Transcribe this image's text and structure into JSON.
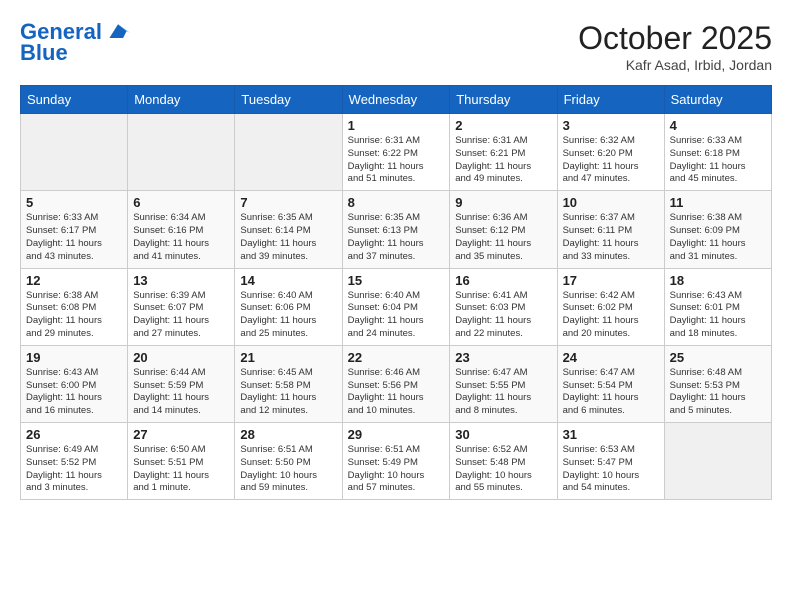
{
  "logo": {
    "line1": "General",
    "line2": "Blue"
  },
  "header": {
    "title": "October 2025",
    "subtitle": "Kafr Asad, Irbid, Jordan"
  },
  "weekdays": [
    "Sunday",
    "Monday",
    "Tuesday",
    "Wednesday",
    "Thursday",
    "Friday",
    "Saturday"
  ],
  "weeks": [
    [
      {
        "day": "",
        "info": ""
      },
      {
        "day": "",
        "info": ""
      },
      {
        "day": "",
        "info": ""
      },
      {
        "day": "1",
        "info": "Sunrise: 6:31 AM\nSunset: 6:22 PM\nDaylight: 11 hours\nand 51 minutes."
      },
      {
        "day": "2",
        "info": "Sunrise: 6:31 AM\nSunset: 6:21 PM\nDaylight: 11 hours\nand 49 minutes."
      },
      {
        "day": "3",
        "info": "Sunrise: 6:32 AM\nSunset: 6:20 PM\nDaylight: 11 hours\nand 47 minutes."
      },
      {
        "day": "4",
        "info": "Sunrise: 6:33 AM\nSunset: 6:18 PM\nDaylight: 11 hours\nand 45 minutes."
      }
    ],
    [
      {
        "day": "5",
        "info": "Sunrise: 6:33 AM\nSunset: 6:17 PM\nDaylight: 11 hours\nand 43 minutes."
      },
      {
        "day": "6",
        "info": "Sunrise: 6:34 AM\nSunset: 6:16 PM\nDaylight: 11 hours\nand 41 minutes."
      },
      {
        "day": "7",
        "info": "Sunrise: 6:35 AM\nSunset: 6:14 PM\nDaylight: 11 hours\nand 39 minutes."
      },
      {
        "day": "8",
        "info": "Sunrise: 6:35 AM\nSunset: 6:13 PM\nDaylight: 11 hours\nand 37 minutes."
      },
      {
        "day": "9",
        "info": "Sunrise: 6:36 AM\nSunset: 6:12 PM\nDaylight: 11 hours\nand 35 minutes."
      },
      {
        "day": "10",
        "info": "Sunrise: 6:37 AM\nSunset: 6:11 PM\nDaylight: 11 hours\nand 33 minutes."
      },
      {
        "day": "11",
        "info": "Sunrise: 6:38 AM\nSunset: 6:09 PM\nDaylight: 11 hours\nand 31 minutes."
      }
    ],
    [
      {
        "day": "12",
        "info": "Sunrise: 6:38 AM\nSunset: 6:08 PM\nDaylight: 11 hours\nand 29 minutes."
      },
      {
        "day": "13",
        "info": "Sunrise: 6:39 AM\nSunset: 6:07 PM\nDaylight: 11 hours\nand 27 minutes."
      },
      {
        "day": "14",
        "info": "Sunrise: 6:40 AM\nSunset: 6:06 PM\nDaylight: 11 hours\nand 25 minutes."
      },
      {
        "day": "15",
        "info": "Sunrise: 6:40 AM\nSunset: 6:04 PM\nDaylight: 11 hours\nand 24 minutes."
      },
      {
        "day": "16",
        "info": "Sunrise: 6:41 AM\nSunset: 6:03 PM\nDaylight: 11 hours\nand 22 minutes."
      },
      {
        "day": "17",
        "info": "Sunrise: 6:42 AM\nSunset: 6:02 PM\nDaylight: 11 hours\nand 20 minutes."
      },
      {
        "day": "18",
        "info": "Sunrise: 6:43 AM\nSunset: 6:01 PM\nDaylight: 11 hours\nand 18 minutes."
      }
    ],
    [
      {
        "day": "19",
        "info": "Sunrise: 6:43 AM\nSunset: 6:00 PM\nDaylight: 11 hours\nand 16 minutes."
      },
      {
        "day": "20",
        "info": "Sunrise: 6:44 AM\nSunset: 5:59 PM\nDaylight: 11 hours\nand 14 minutes."
      },
      {
        "day": "21",
        "info": "Sunrise: 6:45 AM\nSunset: 5:58 PM\nDaylight: 11 hours\nand 12 minutes."
      },
      {
        "day": "22",
        "info": "Sunrise: 6:46 AM\nSunset: 5:56 PM\nDaylight: 11 hours\nand 10 minutes."
      },
      {
        "day": "23",
        "info": "Sunrise: 6:47 AM\nSunset: 5:55 PM\nDaylight: 11 hours\nand 8 minutes."
      },
      {
        "day": "24",
        "info": "Sunrise: 6:47 AM\nSunset: 5:54 PM\nDaylight: 11 hours\nand 6 minutes."
      },
      {
        "day": "25",
        "info": "Sunrise: 6:48 AM\nSunset: 5:53 PM\nDaylight: 11 hours\nand 5 minutes."
      }
    ],
    [
      {
        "day": "26",
        "info": "Sunrise: 6:49 AM\nSunset: 5:52 PM\nDaylight: 11 hours\nand 3 minutes."
      },
      {
        "day": "27",
        "info": "Sunrise: 6:50 AM\nSunset: 5:51 PM\nDaylight: 11 hours\nand 1 minute."
      },
      {
        "day": "28",
        "info": "Sunrise: 6:51 AM\nSunset: 5:50 PM\nDaylight: 10 hours\nand 59 minutes."
      },
      {
        "day": "29",
        "info": "Sunrise: 6:51 AM\nSunset: 5:49 PM\nDaylight: 10 hours\nand 57 minutes."
      },
      {
        "day": "30",
        "info": "Sunrise: 6:52 AM\nSunset: 5:48 PM\nDaylight: 10 hours\nand 55 minutes."
      },
      {
        "day": "31",
        "info": "Sunrise: 6:53 AM\nSunset: 5:47 PM\nDaylight: 10 hours\nand 54 minutes."
      },
      {
        "day": "",
        "info": ""
      }
    ]
  ]
}
